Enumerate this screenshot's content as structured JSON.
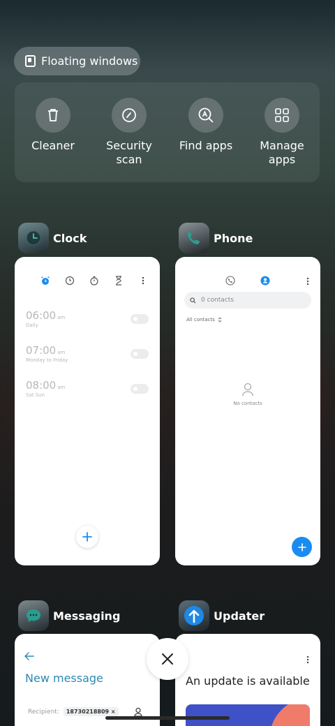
{
  "floating_windows": {
    "label": "Floating windows"
  },
  "tools": [
    {
      "label": "Cleaner",
      "icon": "trash-icon"
    },
    {
      "label": "Security\nscan",
      "icon": "security-scan-icon"
    },
    {
      "label": "Find apps",
      "icon": "find-apps-icon"
    },
    {
      "label": "Manage\napps",
      "icon": "grid-icon"
    }
  ],
  "apps": {
    "clock": {
      "name": "Clock",
      "alarms": [
        {
          "time": "06:00",
          "ampm": "am",
          "repeat": "Daily"
        },
        {
          "time": "07:00",
          "ampm": "am",
          "repeat": "Monday to Friday"
        },
        {
          "time": "08:00",
          "ampm": "am",
          "repeat": "Sat Sun"
        }
      ]
    },
    "phone": {
      "name": "Phone",
      "search_placeholder": "0 contacts",
      "filter_label": "All contacts",
      "empty_label": "No contacts"
    },
    "messaging": {
      "name": "Messaging",
      "title": "New message",
      "recipient_label": "Recipient:",
      "recipient_chip": "18730218809 ×"
    },
    "updater": {
      "name": "Updater",
      "title": "An update is available"
    }
  },
  "colors": {
    "accent_blue": "#1a8cf0",
    "messaging_teal": "#2d8ab0"
  }
}
